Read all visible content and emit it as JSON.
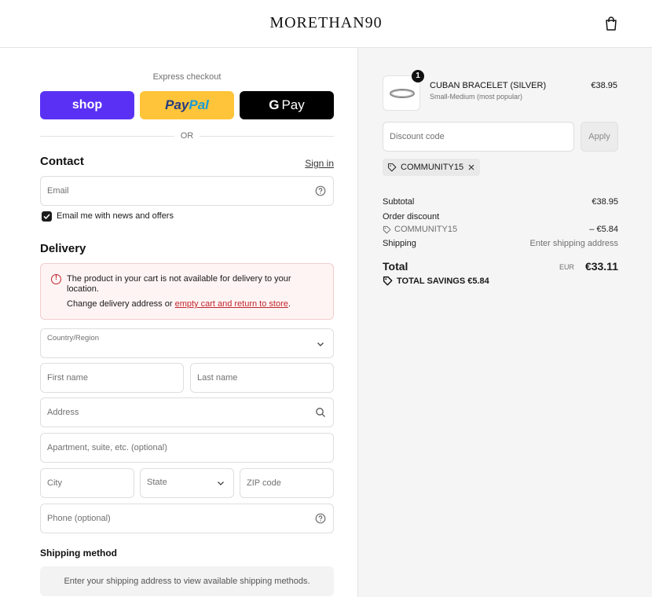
{
  "header": {
    "brand": "MORETHAN90",
    "bag_icon": "bag-icon"
  },
  "express": {
    "label": "Express checkout",
    "shop_label": "shop",
    "paypal_label_a": "Pay",
    "paypal_label_b": "Pal",
    "gpay_g": "G",
    "gpay_label": "Pay",
    "or_label": "OR"
  },
  "contact": {
    "title": "Contact",
    "signin_label": "Sign in",
    "email_placeholder": "Email",
    "newsletter_label": "Email me with news and offers",
    "newsletter_checked": true
  },
  "delivery": {
    "title": "Delivery",
    "alert_message": "The product in your cart is not available for delivery to your location.",
    "alert_prefix": "Change delivery address or ",
    "alert_link": "empty cart and return to store",
    "alert_suffix": ".",
    "country_label": "Country/Region",
    "first_name_placeholder": "First name",
    "last_name_placeholder": "Last name",
    "address_placeholder": "Address",
    "apartment_placeholder": "Apartment, suite, etc. (optional)",
    "city_placeholder": "City",
    "state_placeholder": "State",
    "zip_placeholder": "ZIP code",
    "phone_placeholder": "Phone (optional)"
  },
  "shipping_method": {
    "title": "Shipping method",
    "message": "Enter your shipping address to view available shipping methods."
  },
  "order": {
    "product": {
      "quantity": "1",
      "name": "CUBAN BRACELET (SILVER)",
      "variant": "Small-Medium (most popular)",
      "price": "€38.95"
    },
    "discount_placeholder": "Discount code",
    "apply_label": "Apply",
    "applied_code": "COMMUNITY15",
    "subtotal_label": "Subtotal",
    "subtotal_value": "€38.95",
    "order_discount_label": "Order discount",
    "discount_code_label": "COMMUNITY15",
    "discount_value": "– €5.84",
    "shipping_label": "Shipping",
    "shipping_value": "Enter shipping address",
    "total_label": "Total",
    "currency": "EUR",
    "total_value": "€33.11",
    "savings_label": "TOTAL SAVINGS €5.84"
  },
  "colors": {
    "shop": "#5a31f4",
    "paypal": "#ffc439",
    "alert": "#c0262c"
  }
}
